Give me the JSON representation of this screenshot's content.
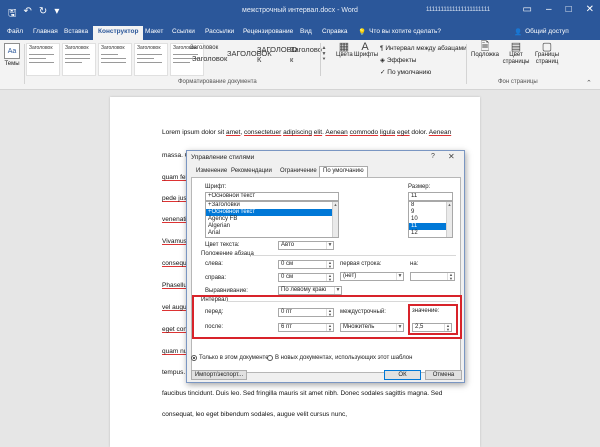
{
  "window": {
    "title": "межстрочный интервал.docx - Word",
    "user": "1111111111111111111111",
    "quick_access_icons": [
      "save-icon",
      "undo-icon",
      "redo-icon",
      "customize-icon"
    ],
    "controls": [
      "ribbon-display-icon",
      "minimize-icon",
      "maximize-icon",
      "close-icon"
    ]
  },
  "menu": {
    "tabs": [
      "Файл",
      "Главная",
      "Вставка",
      "Конструктор",
      "Макет",
      "Ссылки",
      "Рассылки",
      "Рецензирование",
      "Вид",
      "Справка"
    ],
    "active_tab": "Конструктор",
    "tell_me": "Что вы хотите сделать?",
    "share": "Общий доступ"
  },
  "ribbon": {
    "themes_label": "Темы",
    "themes_icon_text": "Aa",
    "style_items": [
      "Заголовок",
      "Заголовок",
      "Заголовок",
      "Заголовок",
      "Заголовок"
    ],
    "style_headings": [
      "ЗАГОЛОВОК",
      "Заголовок",
      "ЗАГОЛОВО К",
      "Заголово к"
    ],
    "gallery_heading_top": "Заголовок",
    "doc_format_label": "Форматирование документа",
    "colors": "Цвета",
    "fonts": "Шрифты",
    "paragraph_spacing": "Интервал между абзацами",
    "effects": "Эффекты",
    "set_default": "По умолчанию",
    "watermark": "Подложка",
    "page_color": "Цвет страницы",
    "page_borders": "Границы страниц",
    "page_bg_label": "Фон страницы"
  },
  "document": {
    "line1": [
      "Lorem ipsum dolor sit ",
      "amet",
      ", ",
      "consectetuer",
      " ",
      "adipiscing",
      " ",
      "elit",
      ". ",
      "Aenean",
      " ",
      "commodo",
      " ",
      "ligula",
      " ",
      "eget",
      " dolor. ",
      "Aenean"
    ],
    "line_massa": "massa. C",
    "left_fragments": [
      "quam fel",
      "pede jus",
      "venenati",
      "Vivamus",
      "consequ",
      "Phasellu",
      "vel augu",
      "eget con",
      "quam nu",
      "tempus."
    ],
    "line_faucibus": "faucibus tincidunt. Duis leo. Sed fringilla mauris sit amet nibh. Donec sodales sagittis magna. Sed",
    "line_consequat": "consequat, leo eget bibendum sodales, augue velit cursus nunc,"
  },
  "dialog": {
    "title": "Управление стилями",
    "help": "?",
    "close": "✕",
    "tabs": [
      "Изменение",
      "Рекомендации",
      "Ограничение",
      "По умолчанию"
    ],
    "active_tab": "По умолчанию",
    "font_label": "Шрифт:",
    "font_value": "+Основной текст",
    "font_list": [
      "+Заголовки",
      "+Основной текст",
      "Agency FB",
      "Algerian",
      "Arial"
    ],
    "font_selected": "+Основной текст",
    "size_label": "Размер:",
    "size_value": "11",
    "size_list": [
      "8",
      "9",
      "10",
      "11",
      "12"
    ],
    "size_selected": "11",
    "color_label": "Цвет текста:",
    "color_value": "Авто",
    "paragraph_group": "Положение абзаца",
    "left_label": "слева:",
    "left_value": "0 см",
    "first_line_label": "первая строка:",
    "first_line_value": "(нет)",
    "on_label": "на:",
    "on_value": "",
    "right_label": "справа:",
    "right_value": "0 см",
    "alignment_label": "Выравнивание:",
    "alignment_value": "По левому краю",
    "spacing_group": "Интервал",
    "before_label": "перед:",
    "before_value": "0 пт",
    "line_spacing_label": "междустрочный:",
    "line_spacing_value": "Множитель",
    "value_label": "значение:",
    "value_value": "2,5",
    "after_label": "после:",
    "after_value": "6 пт",
    "radio_this_doc": "Только в этом документе",
    "radio_new_docs": "В новых документах, использующих этот шаблон",
    "radio_selected": "this_doc",
    "import_export": "Импорт/экспорт...",
    "ok": "ОК",
    "cancel": "Отмена"
  },
  "colors": {
    "titlebar": "#2b579a",
    "highlight": "#d8232a",
    "selection": "#0078d7"
  }
}
